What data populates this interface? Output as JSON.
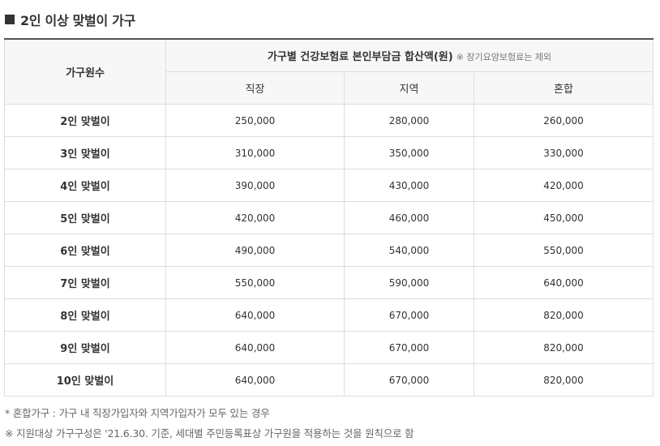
{
  "title": "2인 이상 맞벌이 가구",
  "table": {
    "col_household_label": "가구원수",
    "group_header": "가구별 건강보험료 본인부담금 합산액(원)",
    "group_note": "※ 장기요양보험료는 제외",
    "sub_headers": [
      "직장",
      "지역",
      "혼합"
    ],
    "rows": [
      {
        "label": "2인 맞벌이",
        "values": [
          "250,000",
          "280,000",
          "260,000"
        ]
      },
      {
        "label": "3인 맞벌이",
        "values": [
          "310,000",
          "350,000",
          "330,000"
        ]
      },
      {
        "label": "4인 맞벌이",
        "values": [
          "390,000",
          "430,000",
          "420,000"
        ]
      },
      {
        "label": "5인 맞벌이",
        "values": [
          "420,000",
          "460,000",
          "450,000"
        ]
      },
      {
        "label": "6인 맞벌이",
        "values": [
          "490,000",
          "540,000",
          "550,000"
        ]
      },
      {
        "label": "7인 맞벌이",
        "values": [
          "550,000",
          "590,000",
          "640,000"
        ]
      },
      {
        "label": "8인 맞벌이",
        "values": [
          "640,000",
          "670,000",
          "820,000"
        ]
      },
      {
        "label": "9인 맞벌이",
        "values": [
          "640,000",
          "670,000",
          "820,000"
        ]
      },
      {
        "label": "10인 맞벌이",
        "values": [
          "640,000",
          "670,000",
          "820,000"
        ]
      }
    ]
  },
  "footnotes": [
    "* 혼합가구 : 가구 내 직장가입자와 지역가입자가 모두 있는 경우",
    "※ 지원대상 가구구성은 '21.6.30. 기준, 세대별 주민등록표상 가구원을 적용하는 것을 원칙으로 함"
  ]
}
